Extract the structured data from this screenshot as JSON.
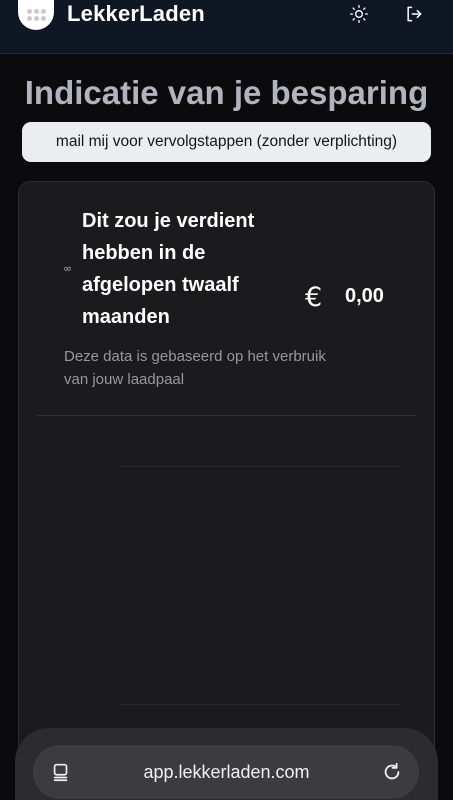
{
  "header": {
    "brand": "LekkerLaden",
    "icons": [
      "logo-icon",
      "sun-icon",
      "logout-icon"
    ]
  },
  "page": {
    "title": "Indicatie van je besparing",
    "mail_button": "mail mij voor vervolgstappen (zonder verplichting)"
  },
  "card": {
    "earned_label": "Dit zou je verdient hebben in de afgelopen twaalf maanden",
    "currency_symbol": "€",
    "amount": "0,00",
    "note": "Deze data is gebaseerd op het verbruik van jouw laadpaal",
    "period_icon": "∞"
  },
  "browser": {
    "url": "app.lekkerladen.com",
    "icons": [
      "tabs-icon",
      "reload-icon"
    ]
  },
  "colors": {
    "header_bg": "#101724",
    "page_bg": "#0b0b0e",
    "card_bg": "#1b1b1e",
    "title": "#b1b4be",
    "button_bg": "#ecedf0"
  }
}
